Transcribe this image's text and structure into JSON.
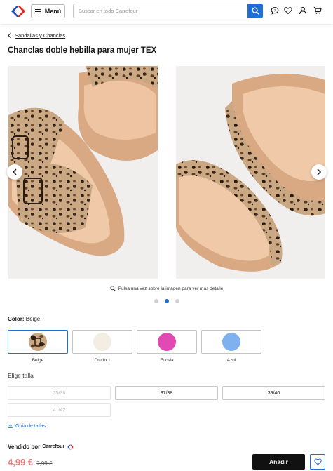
{
  "header": {
    "menu_label": "Menú",
    "search_placeholder": "Buscar en todo Carrefour",
    "icons": [
      "carrefour-logo",
      "search-icon",
      "chat-icon",
      "heart-icon",
      "user-icon",
      "cart-icon"
    ]
  },
  "breadcrumb": {
    "label": "Sandalias y Chanclas"
  },
  "product": {
    "title": "Chanclas doble hebilla para mujer TEX",
    "zoom_hint": "Pulsa una vez sobre la imagen para ver más detalle",
    "gallery": {
      "dots_total": 3,
      "active_dot": 2
    }
  },
  "color": {
    "label": "Color:",
    "selected": "Beige",
    "options": [
      {
        "name": "Beige",
        "swatch": "leopard"
      },
      {
        "name": "Crudo 1",
        "swatch": "#f3ede3"
      },
      {
        "name": "Fucsia",
        "swatch": "#e04ab2"
      },
      {
        "name": "Azul",
        "swatch": "#7fb1ee"
      }
    ]
  },
  "sizes": {
    "label": "Elige talla",
    "options": [
      {
        "label": "35/36",
        "available": false
      },
      {
        "label": "37/38",
        "available": true
      },
      {
        "label": "39/40",
        "available": true
      },
      {
        "label": "41/42",
        "available": false
      }
    ],
    "guide_label": "Guía de tallas"
  },
  "seller": {
    "label": "Vendido por",
    "name": "Carrefour"
  },
  "price": {
    "current": "4,99 €",
    "previous": "7,99 €"
  },
  "actions": {
    "add_label": "Añadir"
  },
  "colors": {
    "accent": "#1e6fd9",
    "price": "#ee7a7a",
    "button": "#111111"
  }
}
